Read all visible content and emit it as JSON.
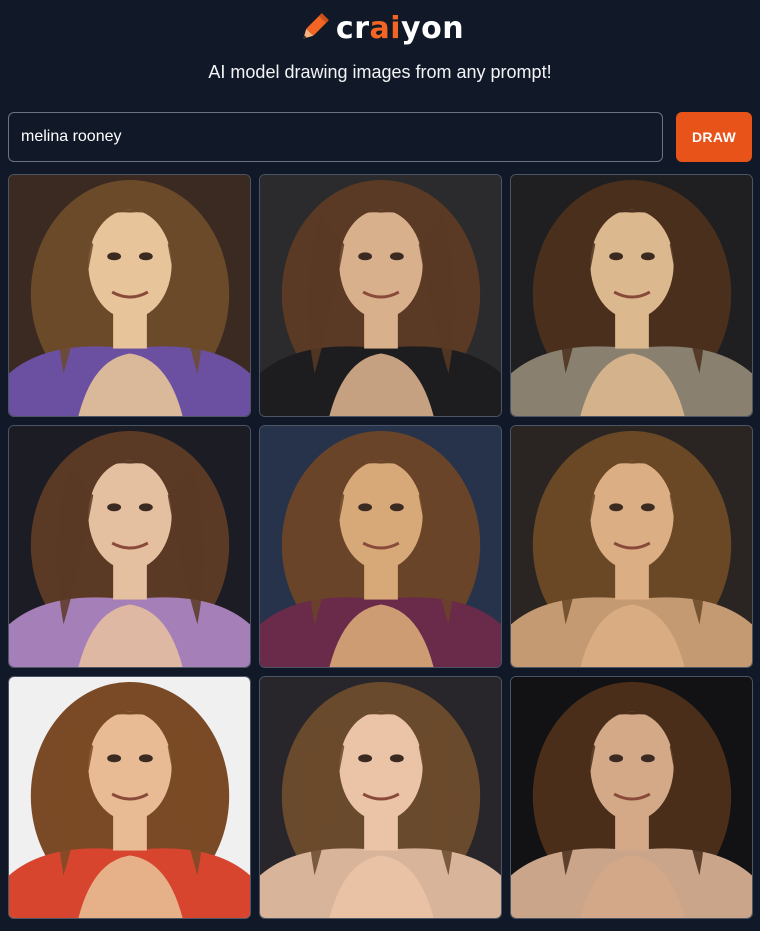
{
  "brand": {
    "prefix": "cr",
    "accent_text": "ai",
    "suffix": "yon",
    "accent_color": "#f26522",
    "icon": "pencil-icon"
  },
  "tagline": "AI model drawing images from any prompt!",
  "search": {
    "value": "melina rooney",
    "placeholder": ""
  },
  "draw_button": {
    "label": "DRAW",
    "color": "#e8531a"
  },
  "results": [
    {
      "bg": "#3a2a22",
      "hair": "#6b4a2a",
      "skin": "#e7c49a",
      "top": "#6b4fa0",
      "jacket": "#3b3a3c"
    },
    {
      "bg": "#2b2a2c",
      "hair": "#5a3a24",
      "skin": "#d9b08c",
      "top": "#1d1d20",
      "jacket": "#1d1d20"
    },
    {
      "bg": "#1f1f22",
      "hair": "#4a301c",
      "skin": "#dcb88f",
      "top": "#8a8070",
      "jacket": "#4a301c"
    },
    {
      "bg": "#1b1c24",
      "hair": "#5a3a24",
      "skin": "#e4bfa0",
      "top": "#a57fb8",
      "jacket": "#2a2a2a"
    },
    {
      "bg": "#26334a",
      "hair": "#6a4428",
      "skin": "#d8a978",
      "top": "#6a2a4a",
      "jacket": "#6a4428"
    },
    {
      "bg": "#2a2522",
      "hair": "#6a4826",
      "skin": "#dcae84",
      "top": "#c49a72",
      "jacket": "#6a4826"
    },
    {
      "bg": "#f0f0f0",
      "hair": "#7a4a26",
      "skin": "#e8bb94",
      "top": "#d8452f",
      "jacket": "#d8452f"
    },
    {
      "bg": "#28262a",
      "hair": "#6a4a2c",
      "skin": "#ebc3a6",
      "top": "#d8b49a",
      "jacket": "#6a4a2c"
    },
    {
      "bg": "#121214",
      "hair": "#4a2e1a",
      "skin": "#d4a988",
      "top": "#caa58a",
      "jacket": "#4a2e1a"
    }
  ]
}
